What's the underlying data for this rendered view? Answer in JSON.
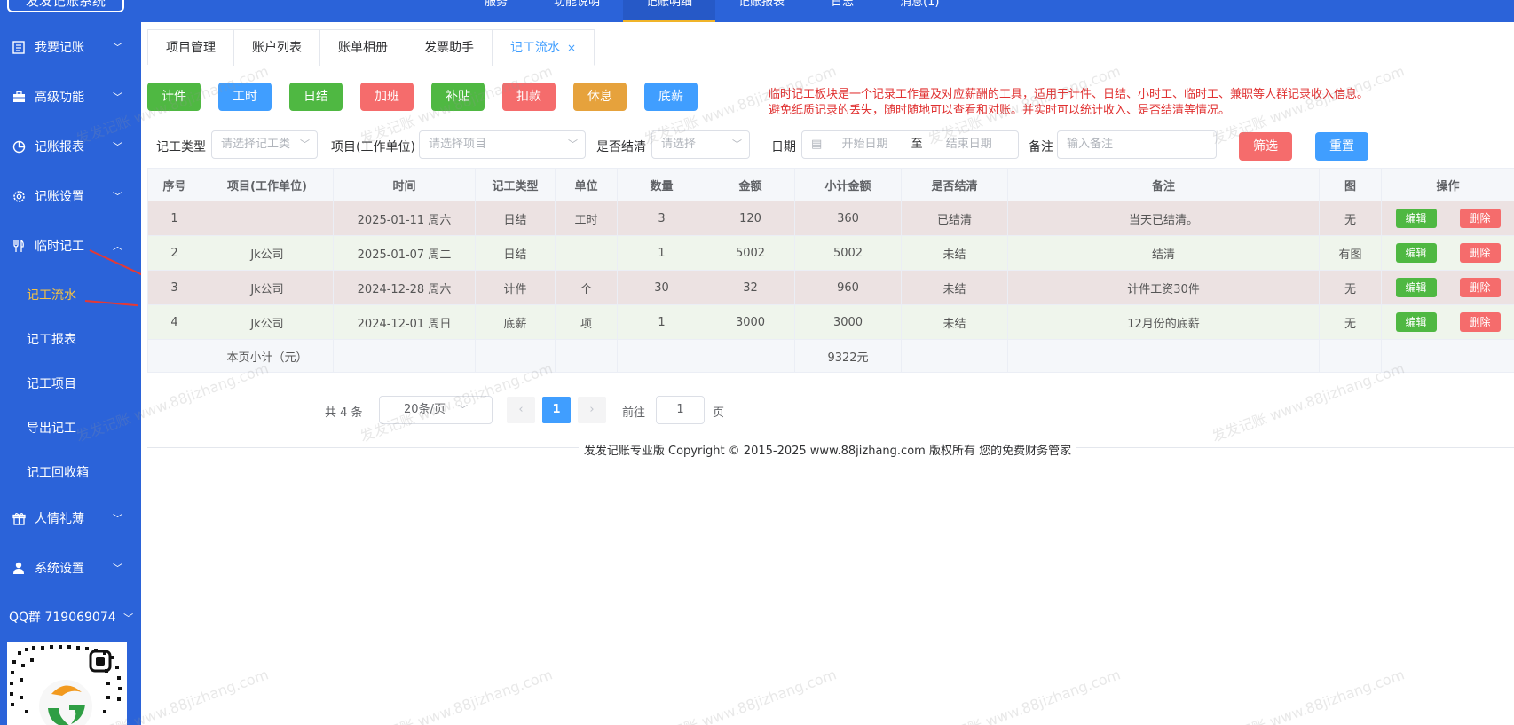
{
  "app": {
    "logo_text": "发发记账系统"
  },
  "top_menu": [
    "服务",
    "功能说明",
    "记账明细",
    "记账报表",
    "日志",
    "消息(1)",
    "",
    "",
    "",
    ""
  ],
  "sidebar": {
    "items": [
      {
        "label": "我要记账"
      },
      {
        "label": "高级功能"
      },
      {
        "label": "记账报表"
      },
      {
        "label": "记账设置"
      },
      {
        "label": "临时记工"
      },
      {
        "label": "人情礼薄"
      },
      {
        "label": "系统设置"
      }
    ],
    "sub_items": [
      "记工流水",
      "记工报表",
      "记工项目",
      "导出记工",
      "记工回收箱"
    ],
    "qq": "QQ群 719069074"
  },
  "tabs": [
    {
      "label": "项目管理"
    },
    {
      "label": "账户列表"
    },
    {
      "label": "账单相册"
    },
    {
      "label": "发票助手"
    },
    {
      "label": "记工流水",
      "close": "×"
    }
  ],
  "quick_buttons": [
    "计件",
    "工时",
    "日结",
    "加班",
    "补贴",
    "扣款",
    "休息",
    "底薪"
  ],
  "notice": {
    "line1": "临时记工板块是一个记录工作量及对应薪酬的工具，适用于计件、日结、小时工、临时工、兼职等人群记录收入信息。",
    "line2": "避免纸质记录的丢失，随时随地可以查看和对账。并实时可以统计收入、是否结清等情况。"
  },
  "filters": {
    "type_label": "记工类型",
    "type_placeholder": "请选择记工类",
    "project_label": "项目(工作单位)",
    "project_placeholder": "请选择项目",
    "settled_label": "是否结清",
    "settled_placeholder": "请选择",
    "date_label": "日期",
    "date_start": "开始日期",
    "date_sep": "至",
    "date_end": "结束日期",
    "remark_label": "备注",
    "remark_placeholder": "输入备注",
    "filter_btn": "筛选",
    "reset_btn": "重置"
  },
  "table": {
    "headers": [
      "序号",
      "项目(工作单位)",
      "时间",
      "记工类型",
      "单位",
      "数量",
      "金额",
      "小计金额",
      "是否结清",
      "备注",
      "图",
      "操作"
    ],
    "rows": [
      [
        "1",
        "",
        "2025-01-11 周六",
        "日结",
        "工时",
        "3",
        "120",
        "360",
        "已结清",
        "当天已结清。",
        "无"
      ],
      [
        "2",
        "Jk公司",
        "2025-01-07 周二",
        "日结",
        "",
        "1",
        "5002",
        "5002",
        "未结",
        "结清",
        "有图"
      ],
      [
        "3",
        "Jk公司",
        "2024-12-28 周六",
        "计件",
        "个",
        "30",
        "32",
        "960",
        "未结",
        "计件工资30件",
        "无"
      ],
      [
        "4",
        "Jk公司",
        "2024-12-01 周日",
        "底薪",
        "项",
        "1",
        "3000",
        "3000",
        "未结",
        "12月份的底薪",
        "无"
      ]
    ],
    "edit_label": "编辑",
    "delete_label": "删除",
    "subtotal_label": "本页小计（元）",
    "subtotal_value": "9322元"
  },
  "pagination": {
    "total": "共 4 条",
    "page_size": "20条/页",
    "prev": "‹",
    "current": "1",
    "next": "›",
    "goto": "前往",
    "goto_value": "1",
    "page_unit": "页"
  },
  "footer": "发发记账专业版  Copyright © 2015-2025 www.88jizhang.com 版权所有    您的免费财务管家",
  "watermark": "发发记账 www.88jizhang.com",
  "colors": {
    "sidebar": "#2b63d9",
    "active_sub": "#f5c244",
    "primary": "#409eff",
    "danger": "#f56c6c",
    "success": "#4fb842",
    "warning": "#e6a23c",
    "notice": "#e03131"
  }
}
